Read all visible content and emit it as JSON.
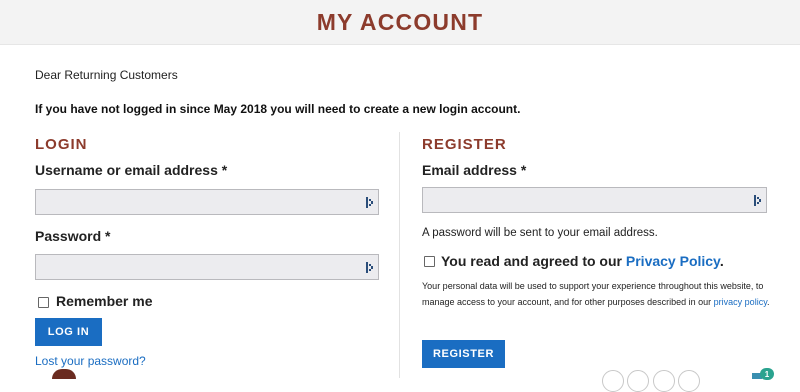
{
  "header": {
    "title": "MY ACCOUNT"
  },
  "intro": {
    "greeting": "Dear Returning Customers",
    "notice": "If you have not logged in since May 2018 you will need to create a new login account."
  },
  "login": {
    "title": "LOGIN",
    "username_label": "Username or email address *",
    "username_value": "",
    "password_label": "Password *",
    "password_value": "",
    "remember_label": "Remember me",
    "remember_checked": false,
    "login_button": "LOG IN",
    "lost_password": "Lost your password?"
  },
  "register": {
    "title": "REGISTER",
    "email_label": "Email address *",
    "email_value": "",
    "hint": "A password will be sent to your email address.",
    "agree_prefix": "You read and agreed to our ",
    "agree_link": "Privacy Policy",
    "agree_suffix": ".",
    "privacy_text": "Your personal data will be used to support your experience throughout this website, to manage access to your account, and for other purposes described in our ",
    "privacy_link": "privacy policy",
    "privacy_suffix": ".",
    "register_button": "REGISTER"
  },
  "chat": {
    "badge_count": "1"
  },
  "colors": {
    "accent": "#8c3b2c",
    "link": "#1a6dc2",
    "button": "#1a6dc2"
  },
  "icons": {
    "field_icon": "password-manager-icon"
  }
}
